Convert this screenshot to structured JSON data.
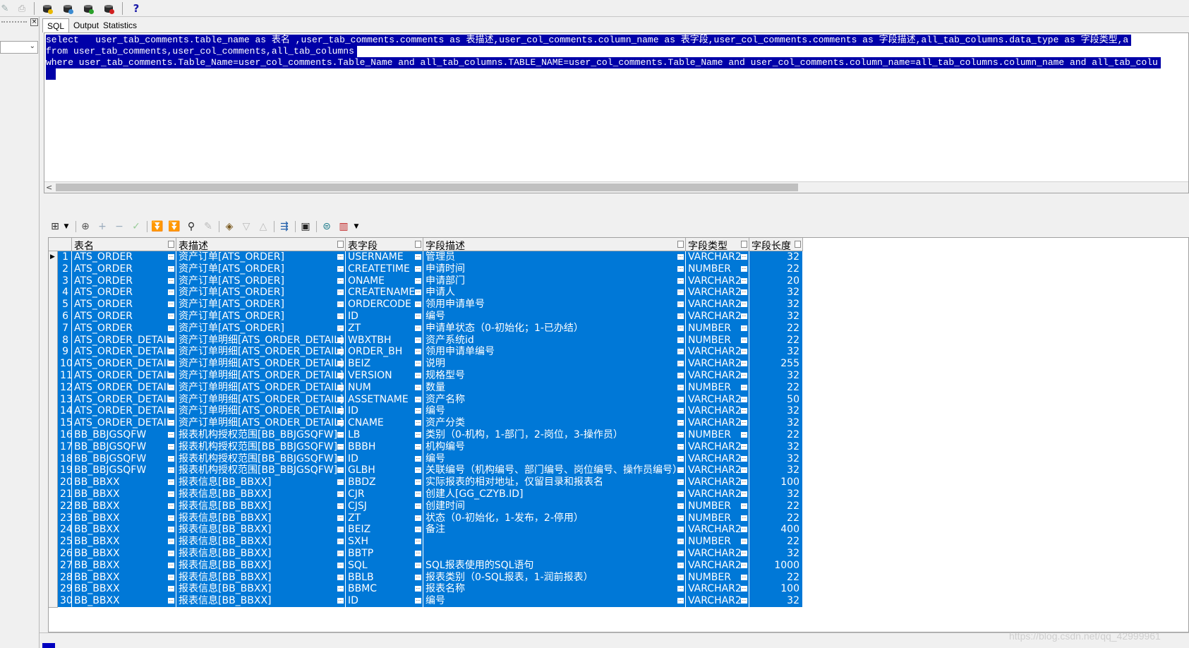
{
  "tabs": [
    "SQL",
    "Output",
    "Statistics"
  ],
  "sql_lines": [
    "select   user_tab_comments.table_name as 表名 ,user_tab_comments.comments as 表描述,user_col_comments.column_name as 表字段,user_col_comments.comments as 字段描述,all_tab_columns.data_type as 字段类型,a",
    "from user_tab_comments,user_col_comments,all_tab_columns",
    "where user_tab_comments.Table_Name=user_col_comments.Table_Name and all_tab_columns.TABLE_NAME=user_col_comments.Table_Name and user_col_comments.column_name=all_tab_columns.column_name and all_tab_colu"
  ],
  "grid": {
    "columns": [
      "表名",
      "表描述",
      "表字段",
      "字段描述",
      "字段类型",
      "字段长度"
    ],
    "rows": [
      [
        "1",
        "ATS_ORDER",
        "资产订单[ATS_ORDER]",
        "USERNAME",
        "管理员",
        "VARCHAR2",
        "32"
      ],
      [
        "2",
        "ATS_ORDER",
        "资产订单[ATS_ORDER]",
        "CREATETIME",
        "申请时间",
        "NUMBER",
        "22"
      ],
      [
        "3",
        "ATS_ORDER",
        "资产订单[ATS_ORDER]",
        "ONAME",
        "申请部门",
        "VARCHAR2",
        "20"
      ],
      [
        "4",
        "ATS_ORDER",
        "资产订单[ATS_ORDER]",
        "CREATENAME",
        "申请人",
        "VARCHAR2",
        "32"
      ],
      [
        "5",
        "ATS_ORDER",
        "资产订单[ATS_ORDER]",
        "ORDERCODE",
        "领用申请单号",
        "VARCHAR2",
        "32"
      ],
      [
        "6",
        "ATS_ORDER",
        "资产订单[ATS_ORDER]",
        "ID",
        "编号",
        "VARCHAR2",
        "32"
      ],
      [
        "7",
        "ATS_ORDER",
        "资产订单[ATS_ORDER]",
        "ZT",
        "申请单状态（0-初始化；1-已办结）",
        "NUMBER",
        "22"
      ],
      [
        "8",
        "ATS_ORDER_DETAIL",
        "资产订单明细[ATS_ORDER_DETAIL]",
        "WBXTBH",
        "资产系统id",
        "NUMBER",
        "22"
      ],
      [
        "9",
        "ATS_ORDER_DETAIL",
        "资产订单明细[ATS_ORDER_DETAIL]",
        "ORDER_BH",
        "领用申请单编号",
        "VARCHAR2",
        "32"
      ],
      [
        "10",
        "ATS_ORDER_DETAIL",
        "资产订单明细[ATS_ORDER_DETAIL]",
        "BEIZ",
        "说明",
        "VARCHAR2",
        "255"
      ],
      [
        "11",
        "ATS_ORDER_DETAIL",
        "资产订单明细[ATS_ORDER_DETAIL]",
        "VERSION",
        "规格型号",
        "VARCHAR2",
        "32"
      ],
      [
        "12",
        "ATS_ORDER_DETAIL",
        "资产订单明细[ATS_ORDER_DETAIL]",
        "NUM",
        "数量",
        "NUMBER",
        "22"
      ],
      [
        "13",
        "ATS_ORDER_DETAIL",
        "资产订单明细[ATS_ORDER_DETAIL]",
        "ASSETNAME",
        "资产名称",
        "VARCHAR2",
        "50"
      ],
      [
        "14",
        "ATS_ORDER_DETAIL",
        "资产订单明细[ATS_ORDER_DETAIL]",
        "ID",
        "编号",
        "VARCHAR2",
        "32"
      ],
      [
        "15",
        "ATS_ORDER_DETAIL",
        "资产订单明细[ATS_ORDER_DETAIL]",
        "CNAME",
        "资产分类",
        "VARCHAR2",
        "32"
      ],
      [
        "16",
        "BB_BBJGSQFW",
        "报表机构授权范围[BB_BBJGSQFW]",
        "LB",
        "类别（0-机构，1-部门，2-岗位，3-操作员）",
        "NUMBER",
        "22"
      ],
      [
        "17",
        "BB_BBJGSQFW",
        "报表机构授权范围[BB_BBJGSQFW]",
        "BBBH",
        "机构编号",
        "VARCHAR2",
        "32"
      ],
      [
        "18",
        "BB_BBJGSQFW",
        "报表机构授权范围[BB_BBJGSQFW]",
        "ID",
        "编号",
        "VARCHAR2",
        "32"
      ],
      [
        "19",
        "BB_BBJGSQFW",
        "报表机构授权范围[BB_BBJGSQFW]",
        "GLBH",
        "关联编号（机构编号、部门编号、岗位编号、操作员编号）",
        "VARCHAR2",
        "32"
      ],
      [
        "20",
        "BB_BBXX",
        "报表信息[BB_BBXX]",
        "BBDZ",
        "实际报表的相对地址，仅留目录和报表名",
        "VARCHAR2",
        "100"
      ],
      [
        "21",
        "BB_BBXX",
        "报表信息[BB_BBXX]",
        "CJR",
        "创建人[GG_CZYB.ID]",
        "VARCHAR2",
        "32"
      ],
      [
        "22",
        "BB_BBXX",
        "报表信息[BB_BBXX]",
        "CJSJ",
        "创建时间",
        "NUMBER",
        "22"
      ],
      [
        "23",
        "BB_BBXX",
        "报表信息[BB_BBXX]",
        "ZT",
        "状态（0-初始化，1-发布，2-停用）",
        "NUMBER",
        "22"
      ],
      [
        "24",
        "BB_BBXX",
        "报表信息[BB_BBXX]",
        "BEIZ",
        "备注",
        "VARCHAR2",
        "400"
      ],
      [
        "25",
        "BB_BBXX",
        "报表信息[BB_BBXX]",
        "SXH",
        "",
        "NUMBER",
        "22"
      ],
      [
        "26",
        "BB_BBXX",
        "报表信息[BB_BBXX]",
        "BBTP",
        "",
        "VARCHAR2",
        "32"
      ],
      [
        "27",
        "BB_BBXX",
        "报表信息[BB_BBXX]",
        "SQL",
        "SQL报表使用的SQL语句",
        "VARCHAR2",
        "1000"
      ],
      [
        "28",
        "BB_BBXX",
        "报表信息[BB_BBXX]",
        "BBLB",
        "报表类别（0-SQL报表，1-润前报表）",
        "NUMBER",
        "22"
      ],
      [
        "29",
        "BB_BBXX",
        "报表信息[BB_BBXX]",
        "BBMC",
        "报表名称",
        "VARCHAR2",
        "100"
      ],
      [
        "30",
        "BB_BBXX",
        "报表信息[BB_BBXX]",
        "ID",
        "编号",
        "VARCHAR2",
        "32"
      ]
    ]
  },
  "watermark": "https://blog.csdn.net/qq_42999961",
  "icons": {
    "top": [
      "db-key-icon",
      "db-stats-icon",
      "db-user-icon",
      "db-flag-icon",
      "help-icon"
    ],
    "grid": [
      "grid-view-icon",
      "lock-icon",
      "add-record-icon",
      "delete-record-icon",
      "post-changes-icon",
      "fetch-next-icon",
      "fetch-last-icon",
      "find-icon",
      "clear-icon",
      "query-by-example-icon",
      "filter-icon",
      "sort-icon",
      "export-icon",
      "save-icon",
      "print-icon",
      "chart-icon"
    ]
  }
}
